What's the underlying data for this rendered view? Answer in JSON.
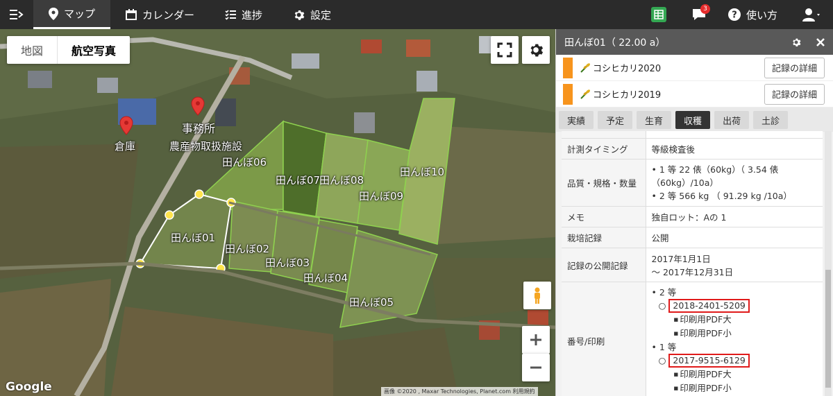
{
  "nav": {
    "items": [
      {
        "label": "マップ",
        "icon": "map-pin-icon"
      },
      {
        "label": "カレンダー",
        "icon": "calendar-icon"
      },
      {
        "label": "進捗",
        "icon": "checklist-icon"
      },
      {
        "label": "設定",
        "icon": "gear-icon"
      }
    ],
    "notifications_count": "3",
    "help_label": "使い方"
  },
  "map": {
    "type_buttons": [
      "地図",
      "航空写真"
    ],
    "markers": [
      "事務所",
      "倉庫"
    ],
    "facility_label": "農産物取扱施設",
    "fields": [
      "田んぼ01",
      "田んぼ02",
      "田んぼ03",
      "田んぼ04",
      "田んぼ05",
      "田んぼ06",
      "田んぼ07",
      "田んぼ08",
      "田んぼ09",
      "田んぼ10"
    ],
    "google": "Google",
    "attribution": "画像 ©2020 , Maxar Technologies, Planet.com   利用規約"
  },
  "panel": {
    "title": "田んぼ01（ 22.00 a）",
    "crops": [
      {
        "name": "コシヒカリ2020",
        "button": "記録の詳細"
      },
      {
        "name": "コシヒカリ2019",
        "button": "記録の詳細"
      }
    ],
    "tabs": [
      "実績",
      "予定",
      "生育",
      "収穫",
      "出荷",
      "土診"
    ],
    "rows": {
      "timing_key": "計測タイミング",
      "timing_val": "等級検査後",
      "quality_key": "品質・規格・数量",
      "quality_1": "1 等 22 俵（60kg）（ 3.54 俵（60kg）/10a）",
      "quality_2": "2 等 566 kg （ 91.29 kg /10a）",
      "memo_key": "メモ",
      "memo_val": "独自ロット：Aの 1",
      "cultivation_key": "栽培記録",
      "cultivation_val": "公開",
      "public_key": "記録の公開記録",
      "public_from": "2017年1月1日",
      "public_to": "〜 2017年12月31日",
      "number_key": "番号/印刷",
      "grade2": "2 等",
      "grade2_code": "2018-2401-5209",
      "grade1": "1 等",
      "grade1_code": "2017-9515-6129",
      "pdf_large": "印刷用PDF大",
      "pdf_small": "印刷用PDF小"
    }
  }
}
